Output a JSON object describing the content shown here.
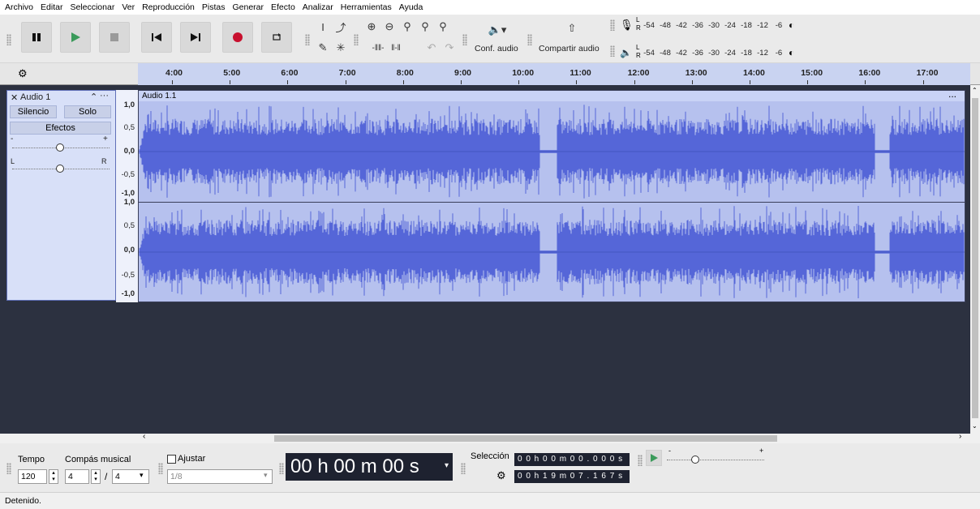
{
  "menu": [
    "Archivo",
    "Editar",
    "Seleccionar",
    "Ver",
    "Reproducción",
    "Pistas",
    "Generar",
    "Efecto",
    "Analizar",
    "Herramientas",
    "Ayuda"
  ],
  "toolbar": {
    "audio_setup_label": "Conf. audio",
    "share_label": "Compartir audio",
    "meter_scale": [
      "-54",
      "-48",
      "-42",
      "-36",
      "-30",
      "-24",
      "-18",
      "-12",
      "-6"
    ],
    "meter_lr": {
      "l": "L",
      "r": "R"
    }
  },
  "ruler": {
    "labels": [
      "4:00",
      "5:00",
      "6:00",
      "7:00",
      "8:00",
      "9:00",
      "10:00",
      "11:00",
      "12:00",
      "13:00",
      "14:00",
      "15:00",
      "16:00",
      "17:00"
    ]
  },
  "track": {
    "name": "Audio 1",
    "mute_label": "Silencio",
    "solo_label": "Solo",
    "effects_label": "Efectos",
    "gain_minus": "-",
    "gain_plus": "+",
    "pan_l": "L",
    "pan_r": "R",
    "clip_name": "Audio 1.1",
    "clip_menu": "...",
    "y_labels": [
      "1,0",
      "0,5",
      "0,0",
      "-0,5",
      "-1,0"
    ]
  },
  "bottom": {
    "tempo_label": "Tempo",
    "tempo_value": "120",
    "meter_label": "Compás musical",
    "meter_num": "4",
    "meter_den": "4",
    "snap_label": "Ajustar",
    "snap_value": "1/8",
    "time_display": "00 h 00 m 00 s",
    "selection_label": "Selección",
    "sel_start": "0 0 h 0 0 m 0 0 . 0 0 0 s",
    "sel_end": "0 0 h 1 9 m 0 7 . 1 6 7 s"
  },
  "status": "Detenido.",
  "colors": {
    "waveform": "#5566d8",
    "clip_bg": "#b6c1ee",
    "record": "#c8102e",
    "play": "#3a9a5a"
  }
}
